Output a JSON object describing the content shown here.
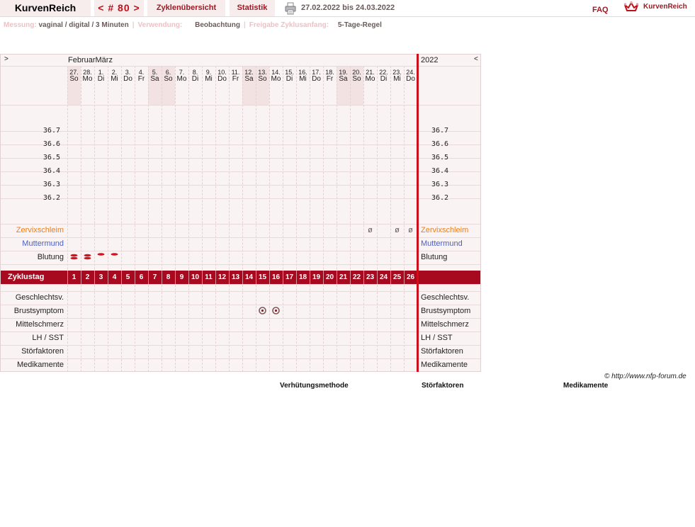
{
  "topbar": {
    "logo": "KurvenReich",
    "cycle": "< # 80 >",
    "overview": "Zyklenübersicht",
    "statistics": "Statistik",
    "print_icon": "printer-icon",
    "date_range": "27.02.2022 bis 24.03.2022",
    "faq": "FAQ",
    "brand_icon": "kurvenreich-crown-icon",
    "brand": "KurvenReich"
  },
  "info": {
    "measure_label": "Messung:",
    "measure_value": "vaginal / digital / 3 Minuten",
    "usage_label": "Verwendung:",
    "usage_value": "Beobachtung",
    "release_label": "Freigabe Zyklusanfang:",
    "release_value": "5-Tage-Regel"
  },
  "chart": {
    "nav_prev": ">",
    "nav_next": "<",
    "months": "FebruarMärz",
    "year": "2022",
    "days": [
      {
        "d": "27.",
        "w": "So",
        "we": true
      },
      {
        "d": "28.",
        "w": "Mo",
        "we": false
      },
      {
        "d": "1.",
        "w": "Di",
        "we": false
      },
      {
        "d": "2.",
        "w": "Mi",
        "we": false
      },
      {
        "d": "3.",
        "w": "Do",
        "we": false
      },
      {
        "d": "4.",
        "w": "Fr",
        "we": false
      },
      {
        "d": "5.",
        "w": "Sa",
        "we": true
      },
      {
        "d": "6.",
        "w": "So",
        "we": true
      },
      {
        "d": "7.",
        "w": "Mo",
        "we": false
      },
      {
        "d": "8.",
        "w": "Di",
        "we": false
      },
      {
        "d": "9.",
        "w": "Mi",
        "we": false
      },
      {
        "d": "10.",
        "w": "Do",
        "we": false
      },
      {
        "d": "11.",
        "w": "Fr",
        "we": false
      },
      {
        "d": "12.",
        "w": "Sa",
        "we": true
      },
      {
        "d": "13.",
        "w": "So",
        "we": true
      },
      {
        "d": "14.",
        "w": "Mo",
        "we": false
      },
      {
        "d": "15.",
        "w": "Di",
        "we": false
      },
      {
        "d": "16.",
        "w": "Mi",
        "we": false
      },
      {
        "d": "17.",
        "w": "Do",
        "we": false
      },
      {
        "d": "18.",
        "w": "Fr",
        "we": false
      },
      {
        "d": "19.",
        "w": "Sa",
        "we": true
      },
      {
        "d": "20.",
        "w": "So",
        "we": true
      },
      {
        "d": "21.",
        "w": "Mo",
        "we": false
      },
      {
        "d": "22.",
        "w": "Di",
        "we": false
      },
      {
        "d": "23.",
        "w": "Mi",
        "we": false
      },
      {
        "d": "24.",
        "w": "Do",
        "we": false
      }
    ],
    "temperatures": [
      "36.7",
      "36.6",
      "36.5",
      "36.4",
      "36.3",
      "36.2"
    ],
    "rows": {
      "cervical_mucus": "Zervixschleim",
      "cervix": "Muttermund",
      "bleeding": "Blutung",
      "cycle_day": "Zyklustag",
      "intercourse": "Geschlechtsv.",
      "breast": "Brustsymptom",
      "midpain": "Mittelschmerz",
      "lh": "LH / SST",
      "disturbance": "Störfaktoren",
      "medication": "Medikamente"
    },
    "colors": {
      "cervical_mucus": "#e8801e",
      "cervix": "#4a5fc4",
      "band": "#a70a1f",
      "cycle_end": "#cc0f1a"
    },
    "cycle_days": [
      "1",
      "2",
      "3",
      "4",
      "5",
      "6",
      "7",
      "8",
      "9",
      "10",
      "11",
      "12",
      "13",
      "14",
      "15",
      "16",
      "17",
      "18",
      "19",
      "20",
      "21",
      "22",
      "23",
      "24",
      "25",
      "26"
    ],
    "mucus_marks": [
      {
        "day": 23,
        "symbol": "ø"
      },
      {
        "day": 25,
        "symbol": "ø"
      },
      {
        "day": 26,
        "symbol": "ø"
      }
    ],
    "bleeding_marks": [
      {
        "day": 1,
        "level": "strong"
      },
      {
        "day": 2,
        "level": "strong"
      },
      {
        "day": 3,
        "level": "light"
      },
      {
        "day": 4,
        "level": "light"
      }
    ],
    "breast_marks": [
      15,
      16
    ]
  },
  "footer": {
    "url": "© http://www.nfp-forum.de",
    "legend_contraception": "Verhütungsmethode",
    "legend_disturbance": "Störfaktoren",
    "legend_medication": "Medikamente"
  }
}
